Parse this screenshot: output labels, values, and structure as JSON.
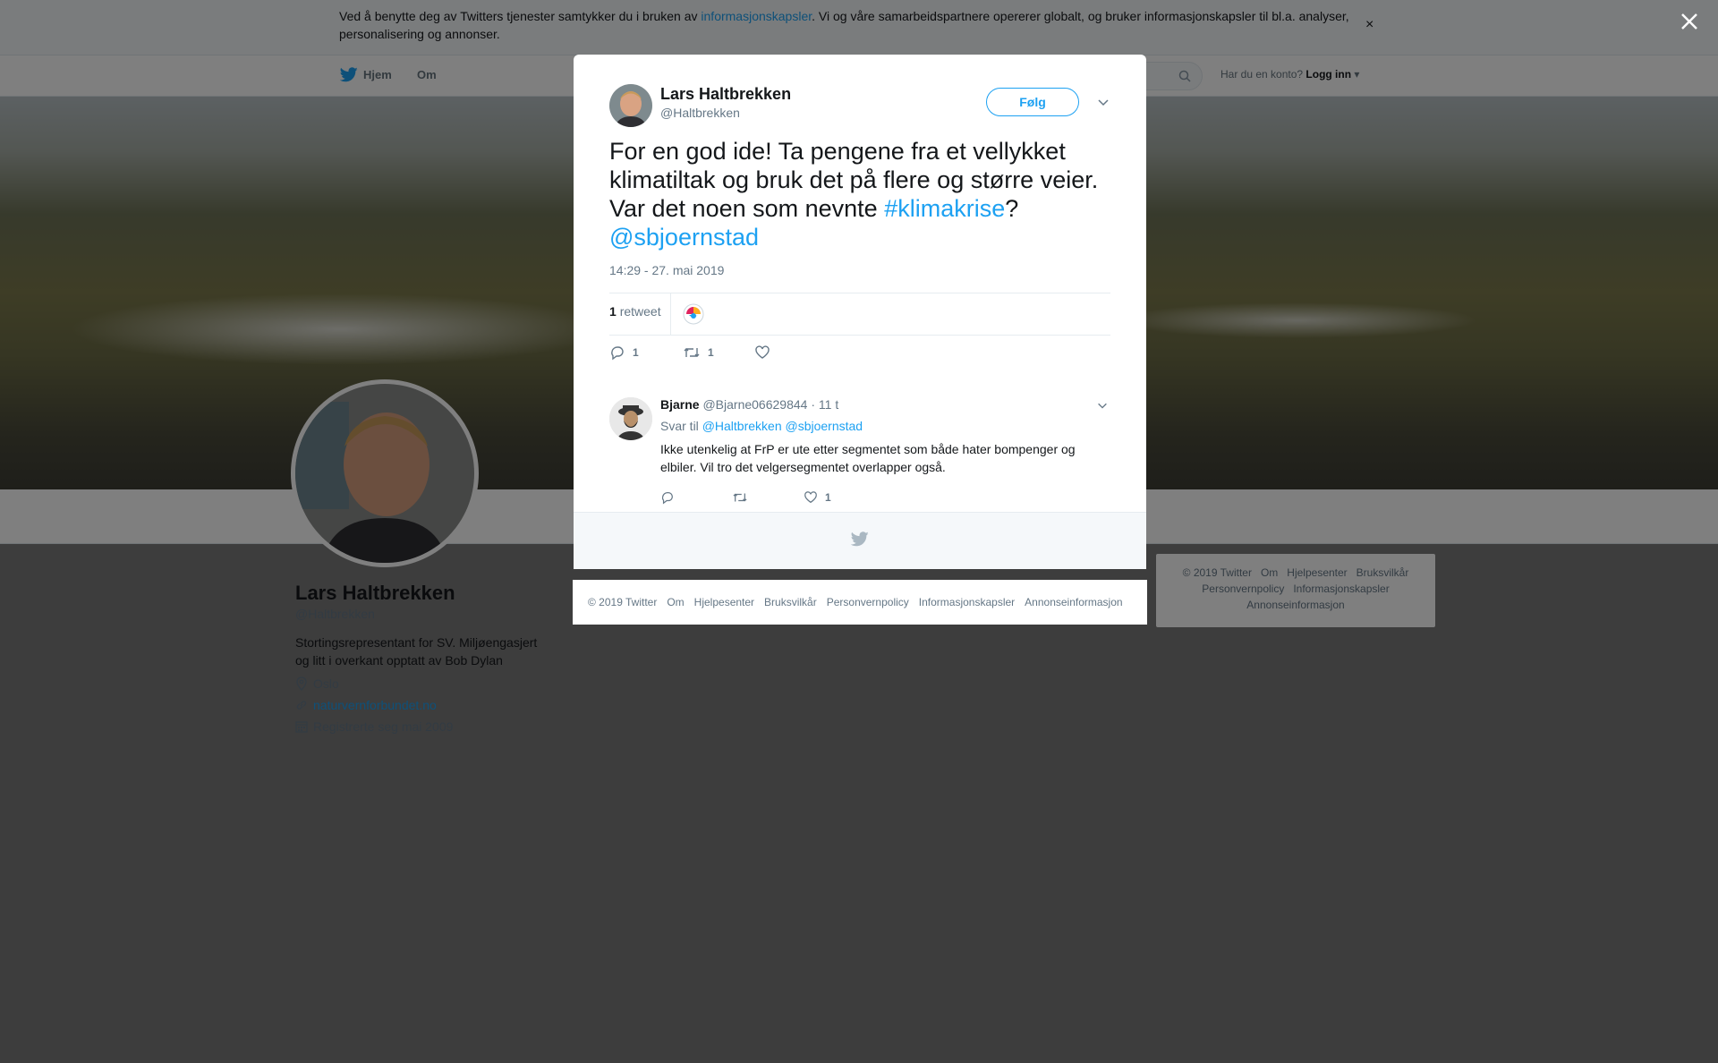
{
  "cookie_bar": {
    "text_before": "Ved å benytte deg av Twitters tjenester samtykker du i bruken av ",
    "link": "informasjonskapsler",
    "text_after": ". Vi og våre samarbeidspartnere opererer globalt, og bruker informasjonskapsler til bl.a. analyser, personalisering og annonser.",
    "close": "×"
  },
  "nav": {
    "home": "Hjem",
    "about": "Om",
    "login_prompt": "Har du en konto?",
    "login": "Logg inn"
  },
  "profile": {
    "name": "Lars Haltbrekken",
    "handle": "@Haltbrekken",
    "bio": "Stortingsrepresentant for SV. Miljøengasjert og litt i overkant opptatt av Bob Dylan",
    "location": "Oslo",
    "website": "naturvernforbundet.no",
    "joined": "Registrerte seg mai 2009"
  },
  "side_footer": {
    "line1": "© 2019 Twitter   Om   Hjelpesenter   Bruksvilkår",
    "line2": "Personvernpolicy   Informasjonskapsler",
    "line3": "Annonseinformasjon"
  },
  "tweet": {
    "author_name": "Lars Haltbrekken",
    "author_handle": "@Haltbrekken",
    "follow_label": "Følg",
    "text_part1": "For en god ide! Ta pengene fra et vellykket klimatiltak og bruk det på flere og større veier. Var det noen som nevnte ",
    "hashtag": "#klimakrise",
    "text_part2": "? ",
    "mention": "@sbjoernstad",
    "timestamp": "14:29 - 27. mai 2019",
    "retweet_count": "1",
    "retweet_label": "retweet",
    "reply_count": "1",
    "retweet_action_count": "1"
  },
  "reply": {
    "name": "Bjarne",
    "handle": "@Bjarne06629844",
    "time": "· 11 t",
    "reply_to_label": "Svar til",
    "reply_to_1": "@Haltbrekken",
    "reply_to_2": "@sbjoernstad",
    "text": "Ikke utenkelig at FrP er ute etter segmentet som både hater bompenger og elbiler. Vil tro det velgersegmentet overlapper også.",
    "like_count": "1"
  },
  "footer": {
    "items": [
      "© 2019 Twitter",
      "Om",
      "Hjelpesenter",
      "Bruksvilkår",
      "Personvernpolicy",
      "Informasjonskapsler",
      "Annonseinformasjon"
    ]
  },
  "colors": {
    "accent": "#1da1f2",
    "text": "#14171a",
    "muted": "#657786"
  }
}
